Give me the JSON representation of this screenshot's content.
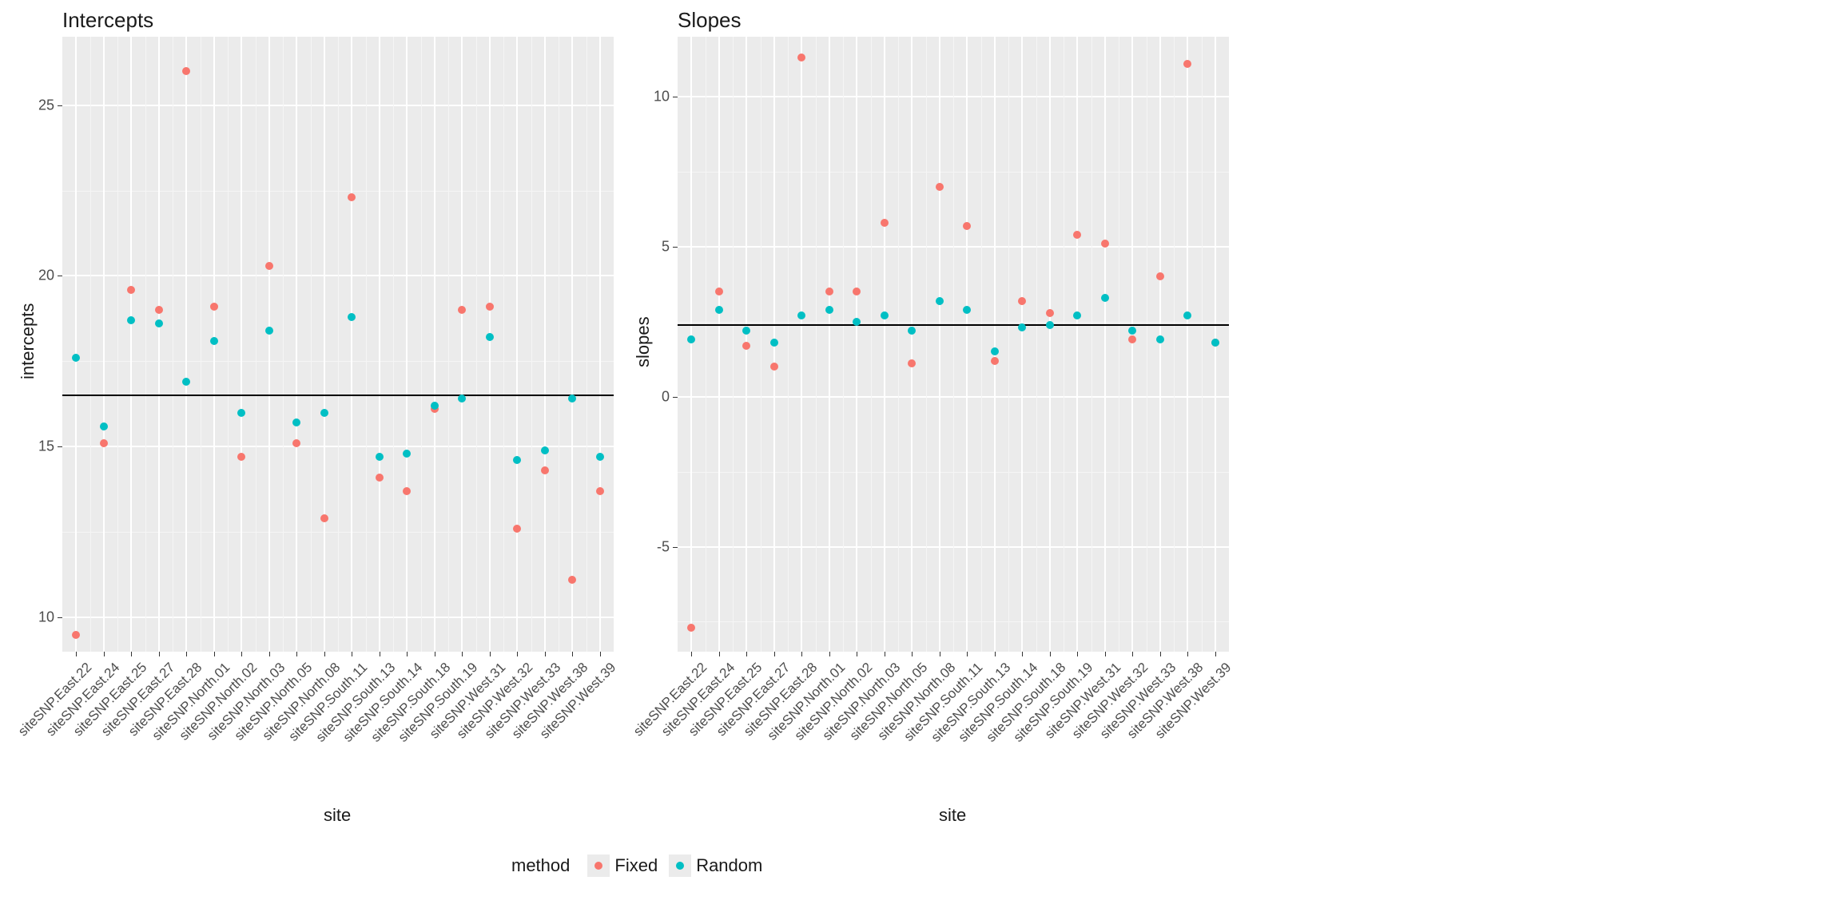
{
  "chart_data": [
    {
      "type": "scatter",
      "title": "Intercepts",
      "xlabel": "site",
      "ylabel": "intercepts",
      "ylim": [
        9,
        27
      ],
      "yticks": [
        10,
        15,
        20,
        25
      ],
      "hline": 16.5,
      "categories": [
        "siteSNP.East.22",
        "siteSNP.East.24",
        "siteSNP.East.25",
        "siteSNP.East.27",
        "siteSNP.East.28",
        "siteSNP.North.01",
        "siteSNP.North.02",
        "siteSNP.North.03",
        "siteSNP.North.05",
        "siteSNP.North.08",
        "siteSNP.South.11",
        "siteSNP.South.13",
        "siteSNP.South.14",
        "siteSNP.South.18",
        "siteSNP.South.19",
        "siteSNP.West.31",
        "siteSNP.West.32",
        "siteSNP.West.33",
        "siteSNP.West.38",
        "siteSNP.West.39"
      ],
      "series": [
        {
          "name": "Fixed",
          "color": "#F8766D",
          "values": [
            9.5,
            15.1,
            19.6,
            19.0,
            26.0,
            19.1,
            14.7,
            20.3,
            15.1,
            12.9,
            22.3,
            14.1,
            13.7,
            16.1,
            19.0,
            19.1,
            12.6,
            14.3,
            11.1,
            13.7
          ]
        },
        {
          "name": "Random",
          "color": "#00BFC4",
          "values": [
            17.6,
            15.6,
            18.7,
            18.6,
            16.9,
            18.1,
            16.0,
            18.4,
            15.7,
            16.0,
            18.8,
            14.7,
            14.8,
            16.2,
            16.4,
            18.2,
            14.6,
            14.9,
            16.4,
            14.7
          ]
        }
      ]
    },
    {
      "type": "scatter",
      "title": "Slopes",
      "xlabel": "site",
      "ylabel": "slopes",
      "ylim": [
        -8.5,
        12
      ],
      "yticks": [
        -5,
        0,
        5,
        10
      ],
      "hline": 2.4,
      "categories": [
        "siteSNP.East.22",
        "siteSNP.East.24",
        "siteSNP.East.25",
        "siteSNP.East.27",
        "siteSNP.East.28",
        "siteSNP.North.01",
        "siteSNP.North.02",
        "siteSNP.North.03",
        "siteSNP.North.05",
        "siteSNP.North.08",
        "siteSNP.South.11",
        "siteSNP.South.13",
        "siteSNP.South.14",
        "siteSNP.South.18",
        "siteSNP.South.19",
        "siteSNP.West.31",
        "siteSNP.West.32",
        "siteSNP.West.33",
        "siteSNP.West.38",
        "siteSNP.West.39"
      ],
      "series": [
        {
          "name": "Fixed",
          "color": "#F8766D",
          "values": [
            -7.7,
            3.5,
            1.7,
            1.0,
            11.3,
            3.5,
            3.5,
            5.8,
            1.1,
            7.0,
            5.7,
            1.2,
            3.2,
            2.8,
            5.4,
            5.1,
            1.9,
            4.0,
            11.1,
            1.8
          ]
        },
        {
          "name": "Random",
          "color": "#00BFC4",
          "values": [
            1.9,
            2.9,
            2.2,
            1.8,
            2.7,
            2.9,
            2.5,
            2.7,
            2.2,
            3.2,
            2.9,
            1.5,
            2.3,
            2.4,
            2.7,
            3.3,
            2.2,
            1.9,
            2.7,
            1.8
          ]
        }
      ]
    }
  ],
  "legend": {
    "title": "method",
    "items": [
      {
        "label": "Fixed",
        "color": "#F8766D"
      },
      {
        "label": "Random",
        "color": "#00BFC4"
      }
    ]
  }
}
